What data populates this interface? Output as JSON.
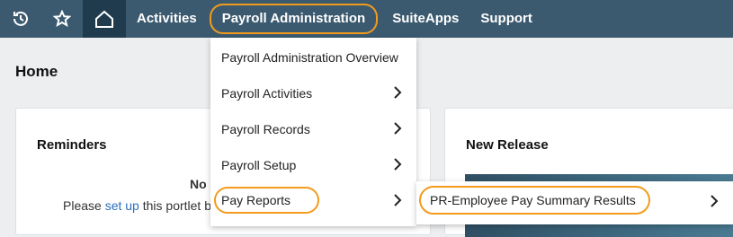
{
  "nav": {
    "icons": [
      "history-icon",
      "star-icon",
      "home-icon"
    ],
    "tabs": [
      "Activities",
      "Payroll Administration",
      "SuiteApps",
      "Support"
    ],
    "active_tab": "Payroll Administration"
  },
  "page": {
    "title": "Home"
  },
  "reminders": {
    "heading": "Reminders",
    "no_text": "No",
    "prefix": "Please",
    "link": "set up",
    "suffix": "this portlet b"
  },
  "new_release": {
    "heading": "New Release"
  },
  "menu": {
    "items": [
      "Payroll Administration Overview",
      "Payroll Activities",
      "Payroll Records",
      "Payroll Setup",
      "Pay Reports"
    ]
  },
  "submenu": {
    "items": [
      "PR-Employee Pay Summary Results"
    ]
  },
  "colors": {
    "navbar": "#3b5a6f",
    "home_tile": "#1f3b4d",
    "highlight_outline": "#f29b1d",
    "link": "#2a6ebb"
  }
}
